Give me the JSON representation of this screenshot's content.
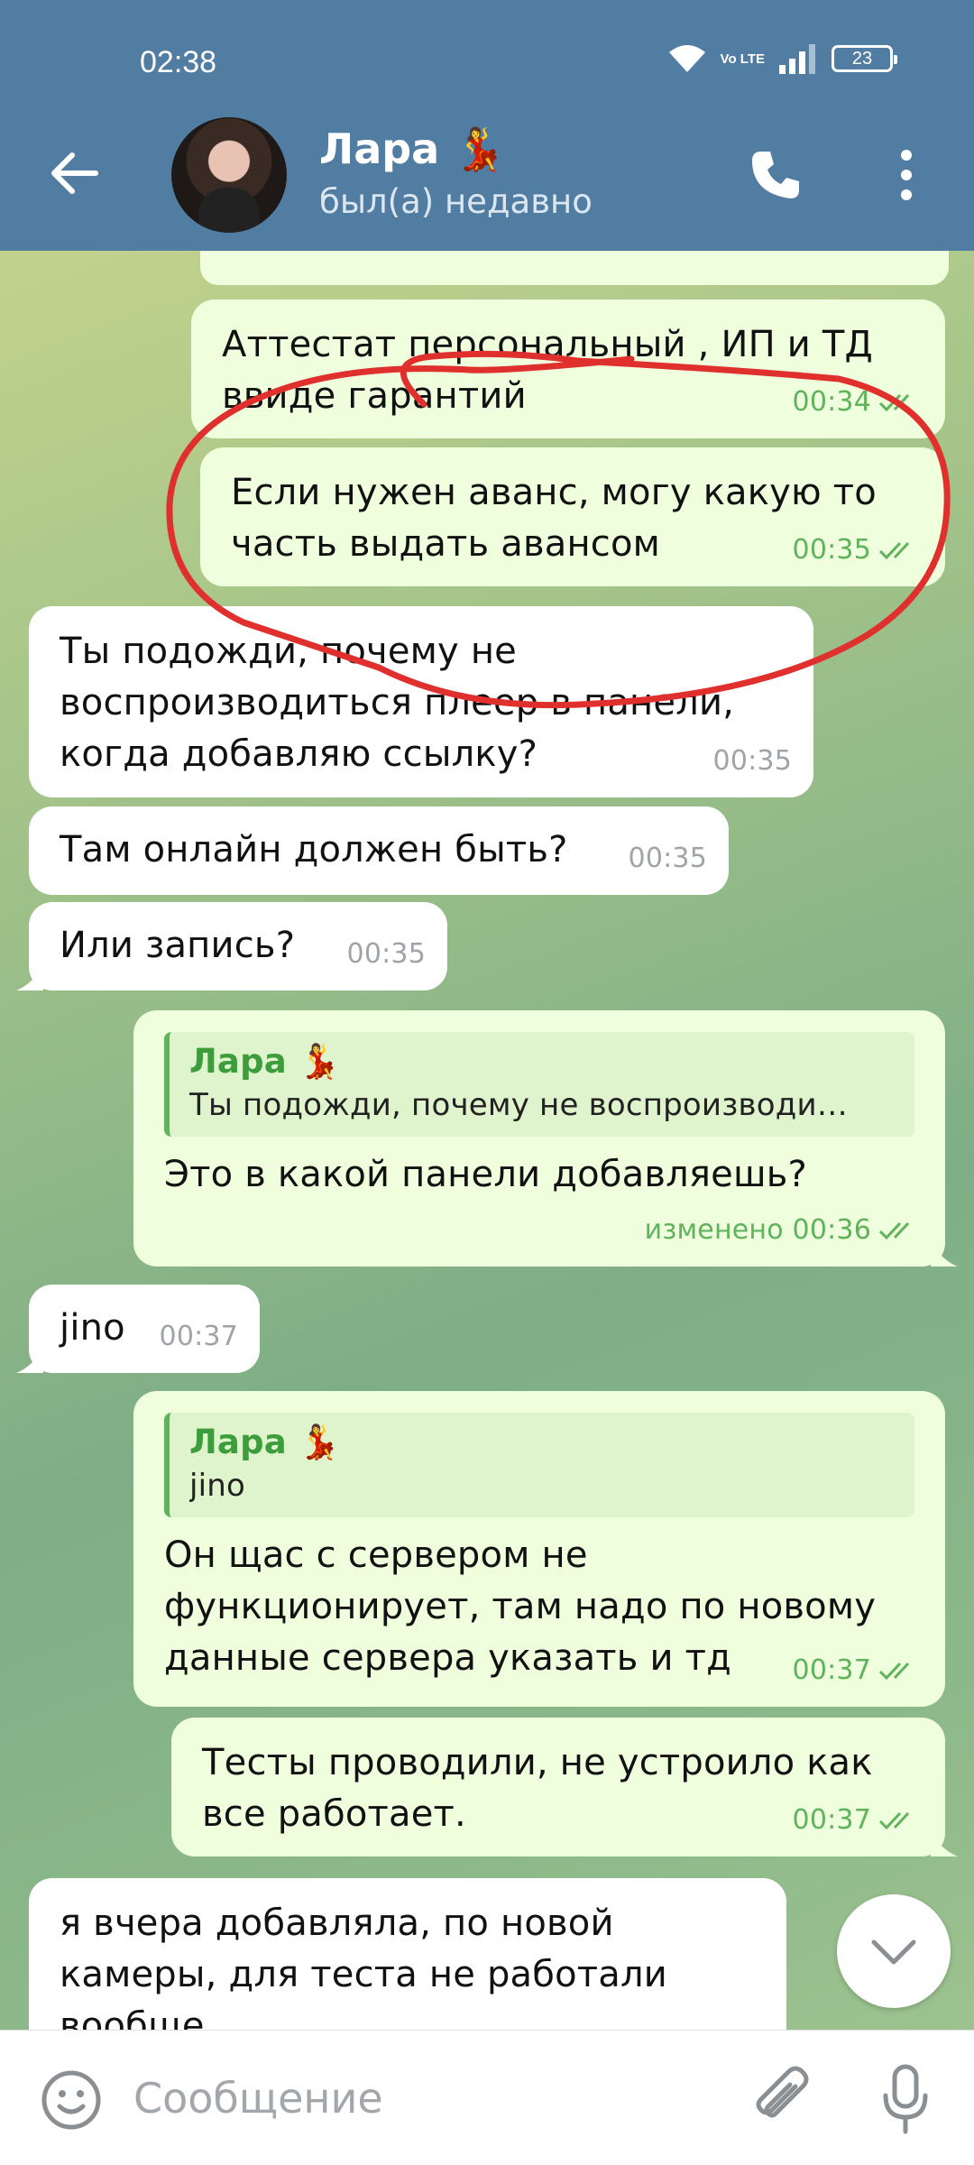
{
  "status_bar": {
    "time": "02:38",
    "network": "Vo LTE",
    "battery": "23"
  },
  "header": {
    "name": "Лара 💃",
    "status": "был(а) недавно"
  },
  "messages": [
    {
      "dir": "out",
      "text": "Аттестат персональный , ИП и ТД ввиде гарантий",
      "time": "00:34"
    },
    {
      "dir": "out",
      "text": "Если нужен аванс, могу какую то часть выдать авансом",
      "time": "00:35"
    },
    {
      "dir": "in",
      "text": "Ты подожди, почему не воспроизводиться плеер в панели, когда добавляю ссылку?",
      "time": "00:35"
    },
    {
      "dir": "in",
      "text": "Там онлайн должен быть?",
      "time": "00:35"
    },
    {
      "dir": "in",
      "text": "Или запись?",
      "time": "00:35"
    },
    {
      "dir": "out",
      "reply_name": "Лара 💃",
      "reply_text": "Ты подожди, почему не воспроизводи…",
      "text": "Это в какой панели добавляешь?",
      "time": "изменено 00:36"
    },
    {
      "dir": "in",
      "text": "jino",
      "time": "00:37"
    },
    {
      "dir": "out",
      "reply_name": "Лара 💃",
      "reply_text": "jino",
      "text": "Он щас с сервером не функционирует, там надо по новому данные сервера указать и тд",
      "time": "00:37"
    },
    {
      "dir": "out",
      "text": "Тесты проводили, не устроило как все работает.",
      "time": "00:37"
    },
    {
      "dir": "in",
      "text": "я вчера добавляла, по новой камеры, для теста не работали вообще",
      "time": ""
    }
  ],
  "input": {
    "placeholder": "Сообщение"
  },
  "colors": {
    "header": "#517da2",
    "out_bubble": "#effedd",
    "in_bubble": "#ffffff",
    "check": "#5fb35b",
    "annotation": "#e0302e"
  },
  "icons": [
    "back-arrow-icon",
    "phone-icon",
    "more-vertical-icon",
    "emoji-icon",
    "paperclip-icon",
    "microphone-icon",
    "chevron-down-icon",
    "double-check-icon"
  ]
}
